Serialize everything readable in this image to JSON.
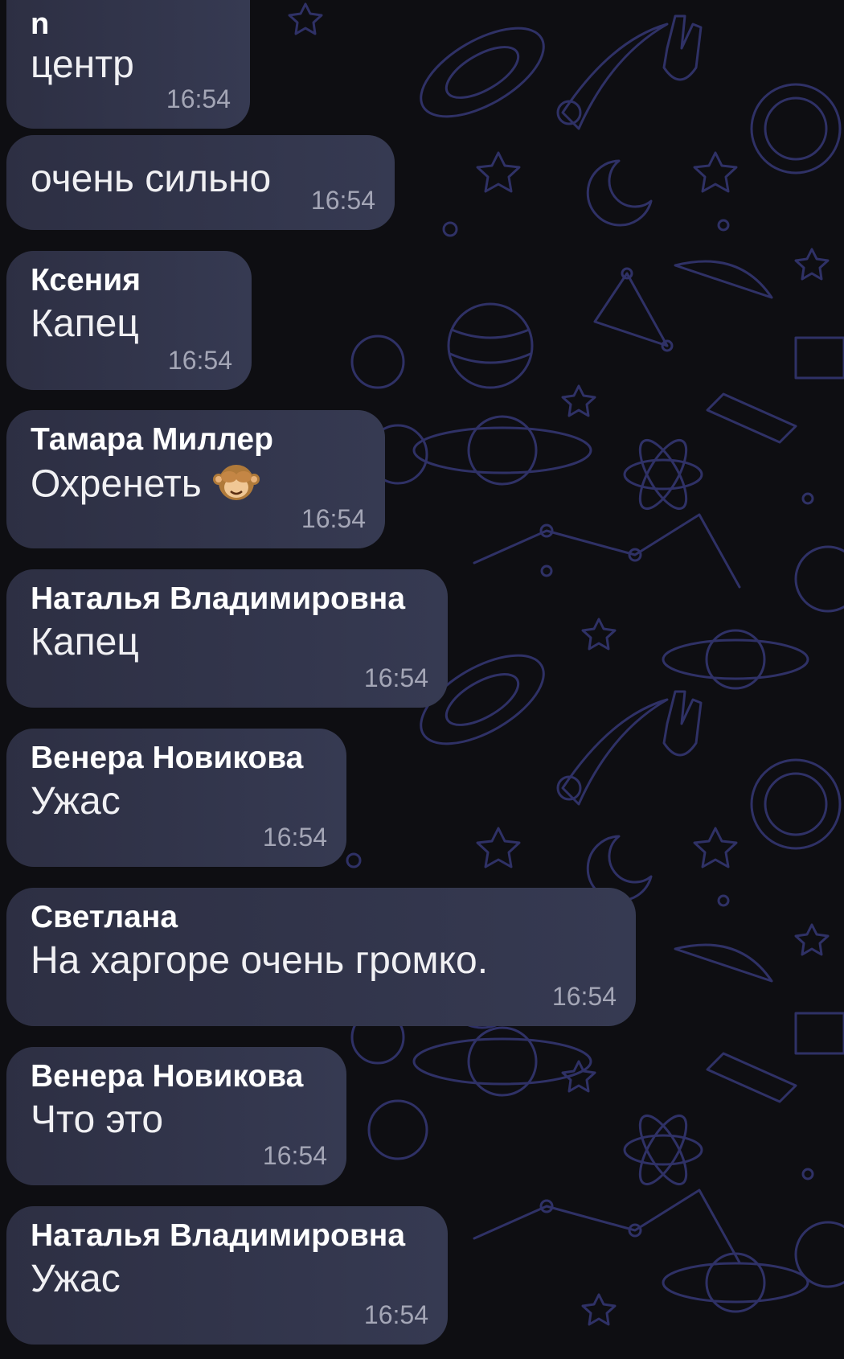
{
  "messages": [
    {
      "sender": "n",
      "text": "центр",
      "time": "16:54"
    },
    {
      "sender": "",
      "text": "очень сильно",
      "time": "16:54"
    },
    {
      "sender": "Ксения",
      "text": "Капец",
      "time": "16:54"
    },
    {
      "sender": "Тамара Миллер",
      "text": "Охренеть",
      "emoji": "see-no-evil-monkey",
      "time": "16:54"
    },
    {
      "sender": "Наталья Владимировна",
      "text": "Капец",
      "time": "16:54"
    },
    {
      "sender": "Венера Новикова",
      "text": "Ужас",
      "time": "16:54"
    },
    {
      "sender": "Светлана",
      "text": "На харгоре очень громко.",
      "time": "16:54"
    },
    {
      "sender": "Венера Новикова",
      "text": "Что это",
      "time": "16:54"
    },
    {
      "sender": "Наталья Владимировна",
      "text": "Ужас",
      "time": "16:54"
    }
  ],
  "colors": {
    "background": "#0e0e12",
    "bubble": "#33364c",
    "pattern": "#2e3060",
    "time_text": "#a4a6b6"
  }
}
